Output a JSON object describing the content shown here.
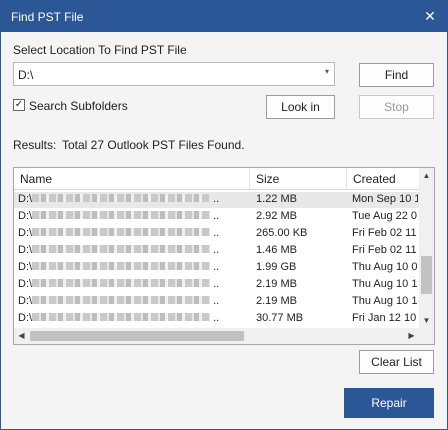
{
  "window": {
    "title": "Find PST File",
    "close_glyph": "✕"
  },
  "location": {
    "label": "Select Location To Find PST File",
    "value": "D:\\",
    "arrow_icon": "▾"
  },
  "buttons": {
    "find": "Find",
    "look_in": "Look in",
    "stop": "Stop",
    "clear_list": "Clear List",
    "repair": "Repair"
  },
  "search_subfolders": {
    "label": "Search Subfolders",
    "checked": true,
    "check_glyph": "✓"
  },
  "results": {
    "label": "Results:",
    "summary": "Total 27 Outlook PST Files Found."
  },
  "table": {
    "columns": [
      "Name",
      "Size",
      "Created"
    ],
    "rows": [
      {
        "name_prefix": "D:\\",
        "name_suffix": "..",
        "size": "1.22 MB",
        "created": "Mon Sep 10 1",
        "selected": true
      },
      {
        "name_prefix": "D:\\",
        "name_suffix": "..",
        "size": "2.92 MB",
        "created": "Tue Aug 22 0",
        "selected": false
      },
      {
        "name_prefix": "D:\\",
        "name_suffix": "..",
        "size": "265.00 KB",
        "created": "Fri Feb 02 11",
        "selected": false
      },
      {
        "name_prefix": "D:\\",
        "name_suffix": "..",
        "size": "1.46 MB",
        "created": "Fri Feb 02 11",
        "selected": false
      },
      {
        "name_prefix": "D:\\",
        "name_suffix": "..",
        "size": "1.99 GB",
        "created": "Thu Aug 10 0",
        "selected": false
      },
      {
        "name_prefix": "D:\\",
        "name_suffix": "..",
        "size": "2.19 MB",
        "created": "Thu Aug 10 1",
        "selected": false
      },
      {
        "name_prefix": "D:\\",
        "name_suffix": "..",
        "size": "2.19 MB",
        "created": "Thu Aug 10 1",
        "selected": false
      },
      {
        "name_prefix": "D:\\",
        "name_suffix": "..",
        "size": "30.77 MB",
        "created": "Fri Jan 12 10",
        "selected": false
      }
    ]
  },
  "scroll_icons": {
    "up": "▲",
    "down": "▼",
    "left": "◀",
    "right": "▶"
  },
  "colors": {
    "titlebar": "#2b5797",
    "repair_button": "#2b5797"
  }
}
